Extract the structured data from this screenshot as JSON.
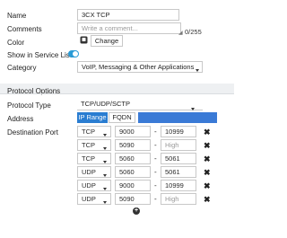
{
  "form": {
    "name": {
      "label": "Name",
      "value": "3CX TCP"
    },
    "comments": {
      "label": "Comments",
      "placeholder": "Write a comment...",
      "counter": "0/255"
    },
    "color": {
      "label": "Color",
      "change_label": "Change"
    },
    "show_in_list": {
      "label": "Show in Service List",
      "enabled": true
    },
    "category": {
      "label": "Category",
      "value": "VoIP, Messaging & Other Applications"
    }
  },
  "protocol_options": {
    "title": "Protocol Options",
    "protocol_type": {
      "label": "Protocol Type",
      "value": "TCP/UDP/SCTP"
    },
    "address": {
      "label": "Address",
      "options": [
        "IP Range",
        "FQDN"
      ],
      "selected": "IP Range"
    },
    "destination_port": {
      "label": "Destination Port",
      "separator": "-",
      "high_placeholder": "High",
      "rows": [
        {
          "protocol": "TCP",
          "low": "9000",
          "high": "10999"
        },
        {
          "protocol": "TCP",
          "low": "5090",
          "high": ""
        },
        {
          "protocol": "TCP",
          "low": "5060",
          "high": "5061"
        },
        {
          "protocol": "UDP",
          "low": "5060",
          "high": "5061"
        },
        {
          "protocol": "UDP",
          "low": "9000",
          "high": "10999"
        },
        {
          "protocol": "UDP",
          "low": "5090",
          "high": ""
        }
      ]
    }
  },
  "colors": {
    "toggle_on": "#2a9bd6",
    "selected_option": "#2a7dd1",
    "address_fill": "#3a7ad6"
  }
}
